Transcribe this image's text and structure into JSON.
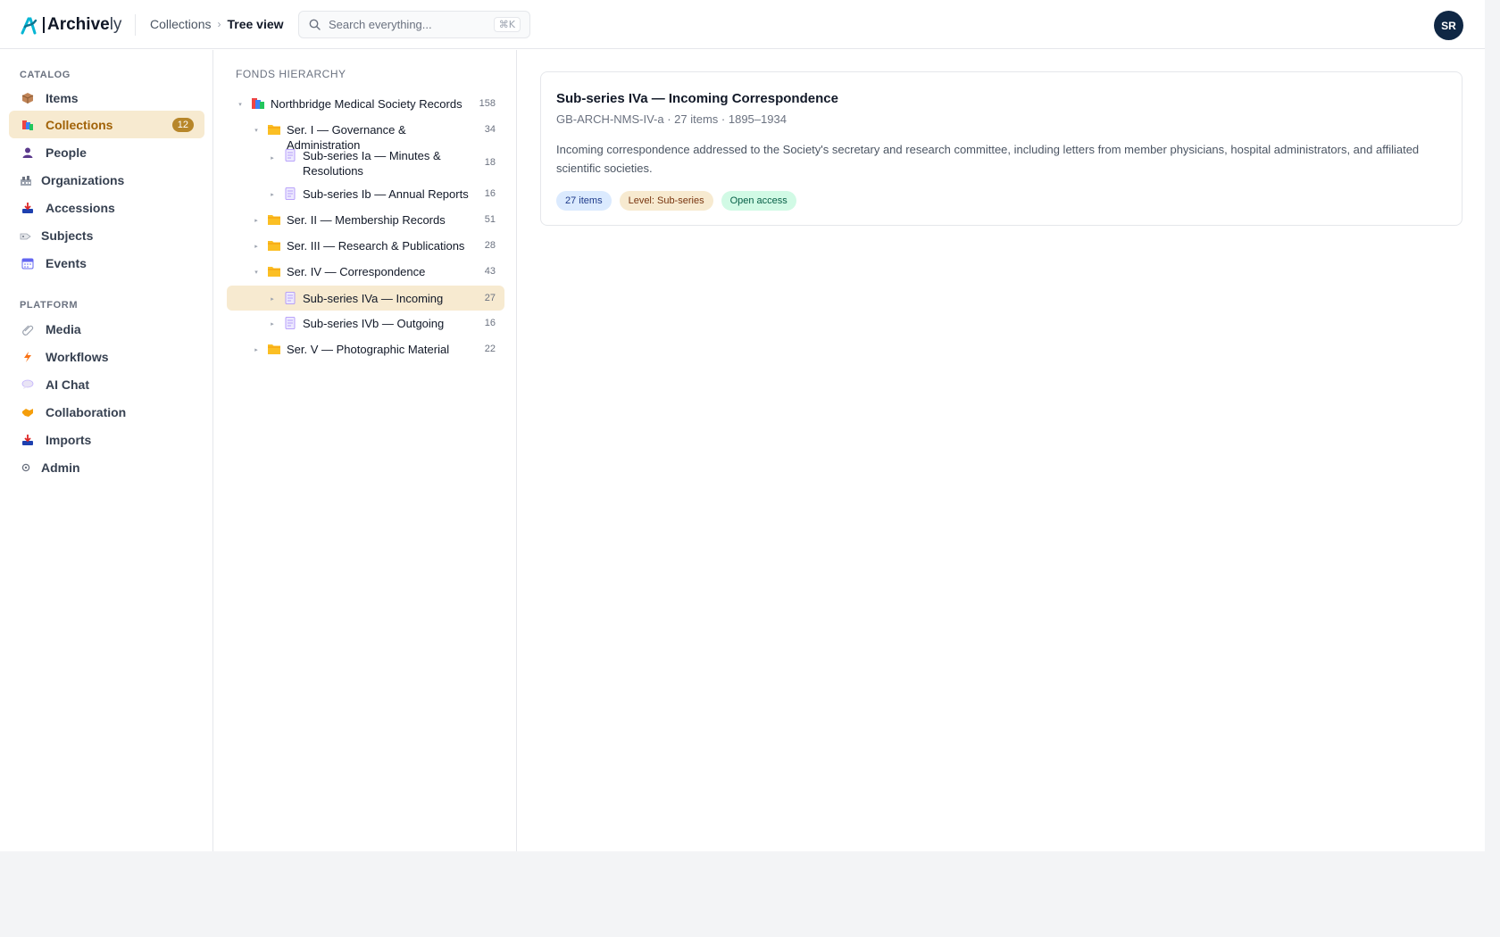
{
  "brand": {
    "name_bold": "Archive",
    "name_light": "ly"
  },
  "breadcrumb": {
    "parent": "Collections",
    "separator": "›",
    "current": "Tree view"
  },
  "search": {
    "placeholder": "Search everything...",
    "shortcut": "⌘K"
  },
  "user": {
    "initials": "SR"
  },
  "sidebar": {
    "catalog_title": "CATALOG",
    "catalog_items": [
      {
        "label": "Items",
        "icon": "package-icon"
      },
      {
        "label": "Collections",
        "icon": "collections-icon",
        "badge": "12",
        "active": true
      },
      {
        "label": "People",
        "icon": "person-icon"
      },
      {
        "label": "Organizations",
        "icon": "building-icon"
      },
      {
        "label": "Accessions",
        "icon": "inbox-tray-icon"
      },
      {
        "label": "Subjects",
        "icon": "tag-icon"
      },
      {
        "label": "Events",
        "icon": "calendar-icon"
      }
    ],
    "platform_title": "PLATFORM",
    "platform_items": [
      {
        "label": "Media",
        "icon": "paperclip-icon"
      },
      {
        "label": "Workflows",
        "icon": "lightning-icon"
      },
      {
        "label": "AI Chat",
        "icon": "speech-bubble-icon"
      },
      {
        "label": "Collaboration",
        "icon": "handshake-icon"
      },
      {
        "label": "Imports",
        "icon": "inbox-tray-icon"
      },
      {
        "label": "Admin",
        "icon": "gear-icon"
      }
    ]
  },
  "tree": {
    "title": "FONDS HIERARCHY",
    "nodes": [
      {
        "label": "Northbridge Medical Society Records",
        "count": "158",
        "level": 0,
        "type": "fonds",
        "toggle": "▾"
      },
      {
        "label": "Ser. I — Governance & Administration",
        "count": "34",
        "level": 1,
        "type": "folder",
        "toggle": "▾"
      },
      {
        "label": "Sub-series Ia — Minutes & Resolutions",
        "count": "18",
        "level": 2,
        "type": "doc",
        "toggle": "▸"
      },
      {
        "label": "Sub-series Ib — Annual Reports",
        "count": "16",
        "level": 2,
        "type": "doc",
        "toggle": "▸"
      },
      {
        "label": "Ser. II — Membership Records",
        "count": "51",
        "level": 1,
        "type": "folder",
        "toggle": "▸"
      },
      {
        "label": "Ser. III — Research & Publications",
        "count": "28",
        "level": 1,
        "type": "folder",
        "toggle": "▸"
      },
      {
        "label": "Ser. IV — Correspondence",
        "count": "43",
        "level": 1,
        "type": "folder",
        "toggle": "▾"
      },
      {
        "label": "Sub-series IVa — Incoming",
        "count": "27",
        "level": 2,
        "type": "doc",
        "toggle": "▸",
        "selected": true
      },
      {
        "label": "Sub-series IVb — Outgoing",
        "count": "16",
        "level": 2,
        "type": "doc",
        "toggle": "▸"
      },
      {
        "label": "Ser. V — Photographic Material",
        "count": "22",
        "level": 1,
        "type": "folder",
        "toggle": "▸"
      }
    ]
  },
  "detail": {
    "title": "Sub-series IVa — Incoming Correspondence",
    "meta": "GB-ARCH-NMS-IV-a · 27 items · 1895–1934",
    "description": "Incoming correspondence addressed to the Society's secretary and research committee, including letters from member physicians, hospital administrators, and affiliated scientific societies.",
    "pills": [
      {
        "label": "27 items",
        "tone": "blue"
      },
      {
        "label": "Level: Sub-series",
        "tone": "amber"
      },
      {
        "label": "Open access",
        "tone": "green"
      }
    ]
  },
  "colors": {
    "accent": "#b7862a",
    "active_bg": "#f7ead0",
    "avatar": "#0f2744"
  }
}
